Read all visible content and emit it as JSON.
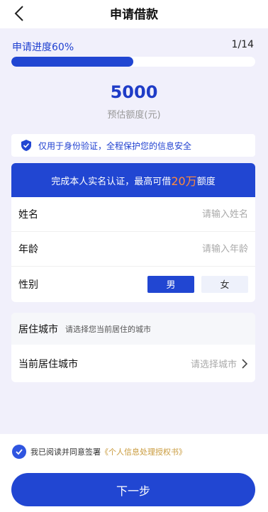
{
  "header": {
    "title": "申请借款"
  },
  "progress": {
    "label": "申请进度60%",
    "count": "1/14",
    "fraction": 0.5
  },
  "amount": {
    "value": "5000",
    "label": "预估额度(元)"
  },
  "security": {
    "text": "仅用于身份验证，全程保护您的信息安全"
  },
  "form": {
    "banner_prefix": "完成本人实名认证，最高可借",
    "banner_highlight": "20万",
    "banner_suffix": "额度",
    "name_label": "姓名",
    "name_placeholder": "请输入姓名",
    "age_label": "年龄",
    "age_placeholder": "请输入年龄",
    "gender_label": "性别",
    "gender_male": "男",
    "gender_female": "女"
  },
  "city": {
    "head_title": "居住城市",
    "head_desc": "请选择您当前居住的城市",
    "row_label": "当前居住城市",
    "row_placeholder": "请选择城市"
  },
  "agreement": {
    "text": "我已阅读并同意签署",
    "link": "《个人信息处理授权书》"
  },
  "next_button": {
    "label": "下一步"
  },
  "colors": {
    "primary": "#2146d2",
    "highlight": "#ff8a3d",
    "link": "#c99a3b"
  }
}
